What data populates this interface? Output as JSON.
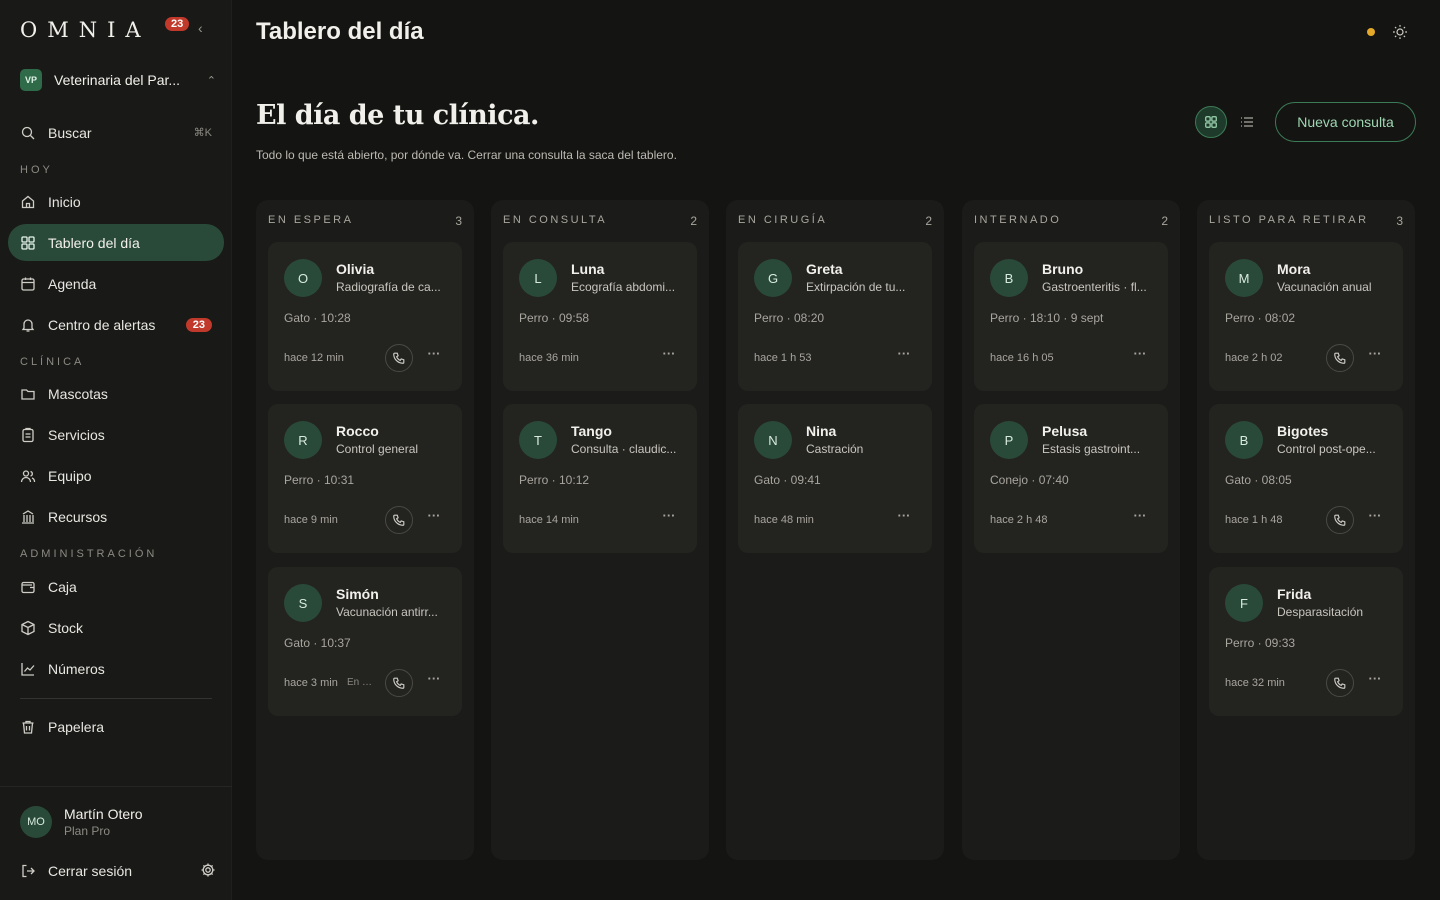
{
  "app": {
    "logo": "OMNIA",
    "notification_count": "23",
    "clinic_initials": "VP",
    "clinic_name": "Veterinaria del Par..."
  },
  "sidebar": {
    "search_label": "Buscar",
    "search_shortcut": "⌘K",
    "sections": {
      "hoy": "HOY",
      "clinica": "CLÍNICA",
      "admin": "ADMINISTRACIÓN"
    },
    "items": {
      "inicio": "Inicio",
      "tablero": "Tablero del día",
      "agenda": "Agenda",
      "alertas": "Centro de alertas",
      "alertas_count": "23",
      "mascotas": "Mascotas",
      "servicios": "Servicios",
      "equipo": "Equipo",
      "recursos": "Recursos",
      "caja": "Caja",
      "stock": "Stock",
      "numeros": "Números",
      "papelera": "Papelera"
    },
    "user": {
      "initials": "MO",
      "name": "Martín Otero",
      "plan": "Plan Pro"
    },
    "logout": "Cerrar sesión"
  },
  "header": {
    "title": "Tablero del día"
  },
  "main": {
    "headline": "El día de tu clínica.",
    "subhead": "Todo lo que está abierto, por dónde va. Cerrar una consulta la saca del tablero.",
    "new_button": "Nueva consulta"
  },
  "columns": [
    {
      "title": "EN ESPERA",
      "count": "3",
      "cards": [
        {
          "initial": "O",
          "name": "Olivia",
          "reason": "Radiografía de ca...",
          "meta": "Gato · 10:28",
          "time": "hace 12 min",
          "extra": "",
          "phone": true
        },
        {
          "initial": "R",
          "name": "Rocco",
          "reason": "Control general",
          "meta": "Perro · 10:31",
          "time": "hace 9 min",
          "extra": "",
          "phone": true
        },
        {
          "initial": "S",
          "name": "Simón",
          "reason": "Vacunación antirr...",
          "meta": "Gato · 10:37",
          "time": "hace 3 min",
          "extra": "En p...",
          "phone": true
        }
      ]
    },
    {
      "title": "EN CONSULTA",
      "count": "2",
      "cards": [
        {
          "initial": "L",
          "name": "Luna",
          "reason": "Ecografía abdomi...",
          "meta": "Perro · 09:58",
          "time": "hace 36 min",
          "extra": "",
          "phone": false
        },
        {
          "initial": "T",
          "name": "Tango",
          "reason": "Consulta · claudic...",
          "meta": "Perro · 10:12",
          "time": "hace 14 min",
          "extra": "",
          "phone": false
        }
      ]
    },
    {
      "title": "EN CIRUGÍA",
      "count": "2",
      "cards": [
        {
          "initial": "G",
          "name": "Greta",
          "reason": "Extirpación de tu...",
          "meta": "Perro · 08:20",
          "time": "hace 1 h 53",
          "extra": "",
          "phone": false
        },
        {
          "initial": "N",
          "name": "Nina",
          "reason": "Castración",
          "meta": "Gato · 09:41",
          "time": "hace 48 min",
          "extra": "",
          "phone": false
        }
      ]
    },
    {
      "title": "INTERNADO",
      "count": "2",
      "cards": [
        {
          "initial": "B",
          "name": "Bruno",
          "reason": "Gastroenteritis · fl...",
          "meta": "Perro · 18:10 · 9 sept",
          "time": "hace 16 h 05",
          "extra": "",
          "phone": false
        },
        {
          "initial": "P",
          "name": "Pelusa",
          "reason": "Estasis gastroint...",
          "meta": "Conejo · 07:40",
          "time": "hace 2 h 48",
          "extra": "",
          "phone": false
        }
      ]
    },
    {
      "title": "LISTO PARA RETIRAR",
      "count": "3",
      "cards": [
        {
          "initial": "M",
          "name": "Mora",
          "reason": "Vacunación anual",
          "meta": "Perro · 08:02",
          "time": "hace 2 h 02",
          "extra": "",
          "phone": true
        },
        {
          "initial": "B",
          "name": "Bigotes",
          "reason": "Control post-ope...",
          "meta": "Gato · 08:05",
          "time": "hace 1 h 48",
          "extra": "",
          "phone": true
        },
        {
          "initial": "F",
          "name": "Frida",
          "reason": "Desparasitación",
          "meta": "Perro · 09:33",
          "time": "hace 32 min",
          "extra": "",
          "phone": true
        }
      ]
    }
  ],
  "colors": {
    "accent": "#2a4a39",
    "accent_border": "#3d7a57",
    "alert": "#c0392b",
    "status_dot": "#e5a92a"
  }
}
